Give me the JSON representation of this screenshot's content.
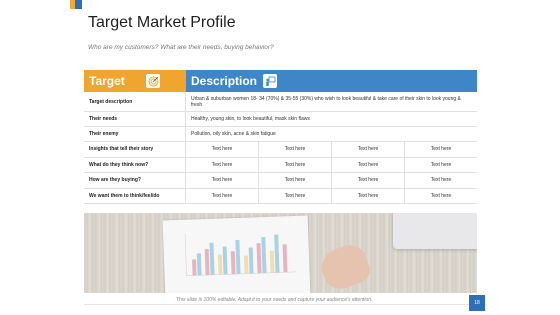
{
  "slide": {
    "title": "Target Market Profile",
    "subtitle": "Who are my customers? What are their needs, buying behavior?",
    "footer": "This slide is 100% editable. Adapt it to your needs and capture your audience's attention.",
    "page_number": "18"
  },
  "table": {
    "header_left": "Target",
    "header_right": "Description",
    "header_left_icon": "target-icon",
    "header_right_icon": "person-board-icon",
    "header_left_color": "#f0a62e",
    "header_right_color": "#3f86c8",
    "rows": [
      {
        "label": "Target description",
        "value": "Urban & suburban women 18- 34 (70%) & 35-55 (30%) who wish to look beautiful & take care of their skin to look young & fresh"
      },
      {
        "label": "Their needs",
        "value": "Healthy, young skin, to look beautiful, mask skin flaws"
      },
      {
        "label": "Their enemy",
        "value": "Pollution, oily skin, acne & skin fatigue"
      }
    ],
    "grid_rows": [
      {
        "label": "Insights that tell their story",
        "cells": [
          "Text here",
          "Text here",
          "Text here",
          "Text here"
        ]
      },
      {
        "label": "What do they think now?",
        "cells": [
          "Text here",
          "Text here",
          "Text here",
          "Text here"
        ]
      },
      {
        "label": "How are they buying?",
        "cells": [
          "Text here",
          "Text here",
          "Text here",
          "Text here"
        ]
      },
      {
        "label": "We want them to think/feel/do",
        "cells": [
          "Text here",
          "Text here",
          "Text here",
          "Text here"
        ]
      }
    ]
  }
}
